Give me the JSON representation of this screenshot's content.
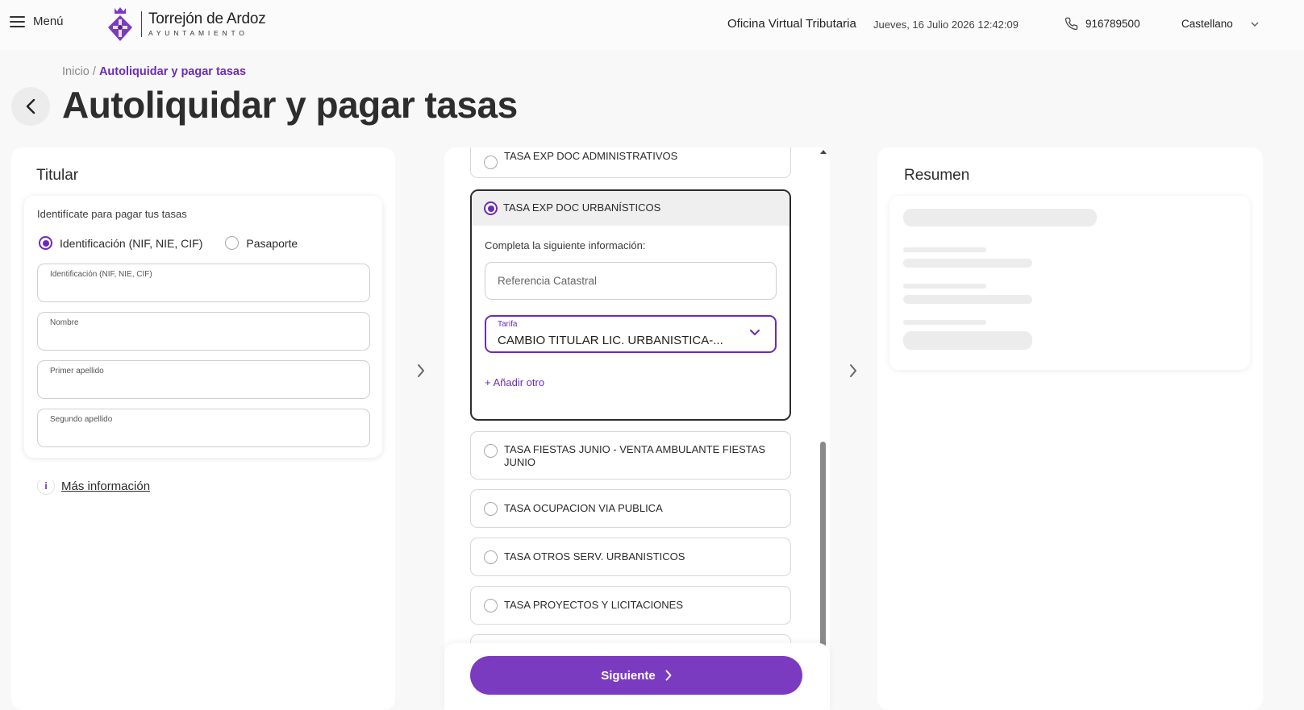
{
  "header": {
    "menu_label": "Menú",
    "logo_name": "Torrejón de Ardoz",
    "logo_sub": "AYUNTAMIENTO",
    "office": "Oficina Virtual Tributaria",
    "datetime": "Jueves, 16 Julio 2026 12:42:09",
    "phone": "916789500",
    "language": "Castellano"
  },
  "breadcrumb": {
    "home": "Inicio",
    "separator": "/",
    "current": "Autoliquidar y pagar tasas"
  },
  "page_title": "Autoliquidar y pagar tasas",
  "titular": {
    "heading": "Titular",
    "intro": "Identifícate para pagar tus tasas",
    "id_types": [
      {
        "label": "Identificación (NIF, NIE, CIF)",
        "selected": true
      },
      {
        "label": "Pasaporte",
        "selected": false
      }
    ],
    "fields": [
      {
        "label": "Identificación (NIF, NIE, CIF)",
        "value": ""
      },
      {
        "label": "Nombre",
        "value": ""
      },
      {
        "label": "Primer apellido",
        "value": ""
      },
      {
        "label": "Segundo apellido",
        "value": ""
      }
    ],
    "more_info": "Más información"
  },
  "tasas": {
    "above": [
      {
        "label": "TASA EXP DOC ADMINISTRATIVOS",
        "selected": false
      }
    ],
    "selected": {
      "label": "TASA EXP DOC URBANÍSTICOS",
      "complete_info": "Completa la siguiente información:",
      "referencia_placeholder": "Referencia Catastral",
      "referencia_value": "",
      "tarifa_label": "Tarifa",
      "tarifa_value": "CAMBIO TITULAR LIC. URBANISTICA-...",
      "add_other": "+ Añadir otro"
    },
    "below": [
      {
        "label": "TASA FIESTAS JUNIO - VENTA AMBULANTE FIESTAS JUNIO",
        "selected": false
      },
      {
        "label": "TASA OCUPACION VIA PUBLICA",
        "selected": false
      },
      {
        "label": "TASA OTROS SERV. URBANISTICOS",
        "selected": false
      },
      {
        "label": "TASA PROYECTOS Y LICITACIONES",
        "selected": false
      }
    ],
    "next_button": "Siguiente"
  },
  "resumen": {
    "heading": "Resumen"
  },
  "colors": {
    "brand_purple": "#6c2bb8",
    "button_purple": "#7b3bc1",
    "page_background": "#f8f8f8"
  }
}
